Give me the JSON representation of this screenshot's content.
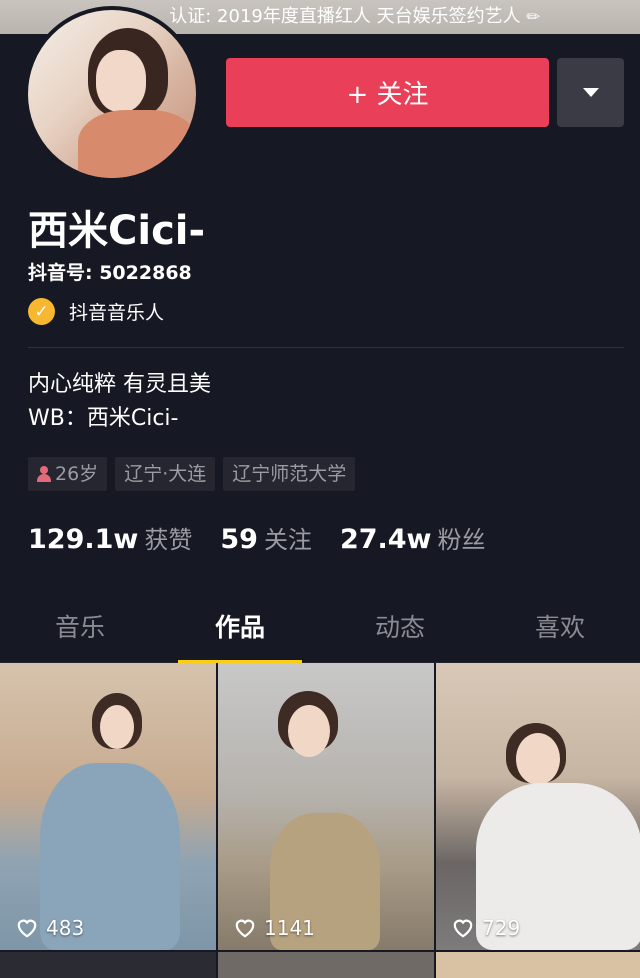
{
  "banner": {
    "text": "认证: 2019年度直播红人 天台娱乐签约艺人",
    "edit_icon": "pencil-icon"
  },
  "actions": {
    "follow_label": "+ 关注",
    "more_icon": "caret-down-icon"
  },
  "profile": {
    "name": "西米Cici-",
    "douyin_id": "抖音号: 5022868",
    "certification": "抖音音乐人",
    "bio_line1": "内心纯粹 有灵且美",
    "bio_line2": "WB：西米Cici-",
    "tags": [
      "26岁",
      "辽宁·大连",
      "辽宁师范大学"
    ]
  },
  "stats": [
    {
      "value": "129.1w",
      "label": "获赞"
    },
    {
      "value": "59",
      "label": "关注"
    },
    {
      "value": "27.4w",
      "label": "粉丝"
    }
  ],
  "tabs": [
    "音乐",
    "作品",
    "动态",
    "喜欢"
  ],
  "active_tab": "作品",
  "videos": [
    {
      "likes": "483"
    },
    {
      "likes": "1141"
    },
    {
      "likes": "729"
    }
  ],
  "colors": {
    "background": "#161823",
    "accent": "#ea3f58",
    "tab_indicator": "#face15"
  }
}
